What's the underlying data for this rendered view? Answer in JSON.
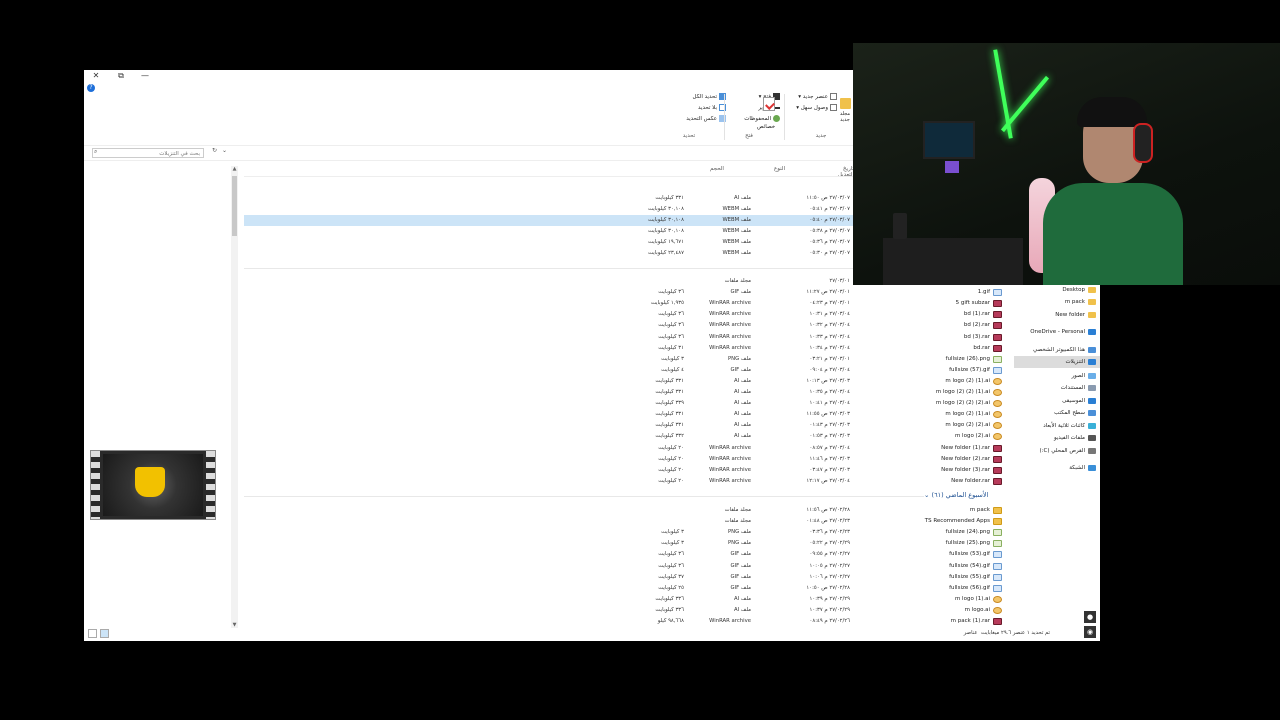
{
  "window": {
    "minimize": "—",
    "restore": "⧉",
    "close": "✕",
    "help": "?"
  },
  "ribbon": {
    "new_group_label": "جديد",
    "new_item": "عنصر جديد",
    "easy_access": "وصول سهل",
    "new_folder": "مجلد جديد",
    "properties": "خصائص",
    "open": "فتح",
    "edit": "تحرير",
    "history": "المحفوظات",
    "open_group_label": "فتح",
    "select_all": "تحديد الكل",
    "select_none": "بلا تحديد",
    "invert_selection": "عكس التحديد",
    "select_group_label": "تحديد"
  },
  "search": {
    "placeholder": "بحث في التنزيلات"
  },
  "columns": {
    "modified": "تاريخ التعديل",
    "type": "النوع",
    "size": "الحجم"
  },
  "top_rows": [
    {
      "date": "٢٧/٠٣/٠٧ ص ١١:٥٠",
      "type": "ملف AI",
      "size": "٣٣١ كيلوبايت",
      "selected": false
    },
    {
      "date": "٢٧/٠٣/٠٧ م ٠٥:٤١",
      "type": "ملف WEBM",
      "size": "٣٠,١٠٨ كيلوبايت",
      "selected": false
    },
    {
      "date": "٢٧/٠٣/٠٧ م ٠٥:٤٠",
      "type": "ملف WEBM",
      "size": "٣٠,١٠٨ كيلوبايت",
      "selected": true
    },
    {
      "date": "٢٧/٠٣/٠٧ م ٠٥:٣٨",
      "type": "ملف WEBM",
      "size": "٣٠,١٠٨ كيلوبايت",
      "selected": false
    },
    {
      "date": "٢٧/٠٣/٠٧ م ٠٥:٣٦",
      "type": "ملف WEBM",
      "size": "١٩,٦٧١ كيلوبايت",
      "selected": false
    },
    {
      "date": "٢٧/٠٣/٠٧ م ٠٥:٣٠",
      "type": "ملف WEBM",
      "size": "٢٣,٤٨٧ كيلوبايت",
      "selected": false
    }
  ],
  "earlier_rows": [
    {
      "name": "",
      "icon": "folder",
      "date": "٢٧/٠٣/٠١",
      "type": "مجلد ملفات",
      "size": ""
    },
    {
      "name": "1.gif",
      "icon": "gif",
      "date": "٢٧/٠٣/٠١ ص ١١:٢٧",
      "type": "ملف GIF",
      "size": "٣٦ كيلوبايت"
    },
    {
      "name": "5 gift subzar",
      "icon": "rar",
      "date": "٢٧/٠٣/٠١ م ٠٤:٢٣",
      "type": "WinRAR archive",
      "size": "١,٩٣٥ كيلوبايت"
    },
    {
      "name": "bd (1).rar",
      "icon": "rar",
      "date": "٢٧/٠٣/٠٤ م ١٠:٣١",
      "type": "WinRAR archive",
      "size": "٣٦ كيلوبايت"
    },
    {
      "name": "bd (2).rar",
      "icon": "rar",
      "date": "٢٧/٠٣/٠٤ م ١٠:٣٢",
      "type": "WinRAR archive",
      "size": "٣٦ كيلوبايت"
    },
    {
      "name": "bd (3).rar",
      "icon": "rar",
      "date": "٢٧/٠٣/٠٤ م ١٠:٣٣",
      "type": "WinRAR archive",
      "size": "٣٦ كيلوبايت"
    },
    {
      "name": "bd.rar",
      "icon": "rar",
      "date": "٢٧/٠٣/٠٤ م ١٠:٣٤",
      "type": "WinRAR archive",
      "size": "٣١ كيلوبايت"
    },
    {
      "name": "fullsize (26).png",
      "icon": "png",
      "date": "٢٧/٠٣/٠١ م ٠٣:٢١",
      "type": "ملف PNG",
      "size": "٣ كيلوبايت"
    },
    {
      "name": "fullsize (57).gif",
      "icon": "gif",
      "date": "٢٧/٠٣/٠٤ م ٠٩:٠٤",
      "type": "ملف GIF",
      "size": "٤ كيلوبايت"
    },
    {
      "name": "m logo (2) (1).ai",
      "icon": "ai",
      "date": "٢٧/٠٣/٠٣ ص ١٠:١٣",
      "type": "ملف AI",
      "size": "٣٣١ كيلوبايت"
    },
    {
      "name": "m logo (2) (2) (1).ai",
      "icon": "ai",
      "date": "٢٧/٠٣/٠٤ م ١٠:٣٥",
      "type": "ملف AI",
      "size": "٣٣١ كيلوبايت"
    },
    {
      "name": "m logo (2) (2) (2).ai",
      "icon": "ai",
      "date": "٢٧/٠٣/٠٤ م ١٠:٤١",
      "type": "ملف AI",
      "size": "٣٣٩ كيلوبايت"
    },
    {
      "name": "m logo (2) (1).ai",
      "icon": "ai",
      "date": "٢٧/٠٣/٠٣ ص ١١:٥٥",
      "type": "ملف AI",
      "size": "٣٣١ كيلوبايت"
    },
    {
      "name": "m logo (2) (2).ai",
      "icon": "ai",
      "date": "٢٧/٠٣/٠٣ م ٠١:٤٣",
      "type": "ملف AI",
      "size": "٣٣١ كيلوبايت"
    },
    {
      "name": "m logo (2).ai",
      "icon": "ai",
      "date": "٢٧/٠٣/٠٣ م ٠١:٥٣",
      "type": "ملف AI",
      "size": "٣٣٢ كيلوبايت"
    },
    {
      "name": "New folder (1).rar",
      "icon": "rar",
      "date": "٢٧/٠٣/٠٤ م ٠٨:٥٧",
      "type": "WinRAR archive",
      "size": "٢٠ كيلوبايت"
    },
    {
      "name": "New folder (2).rar",
      "icon": "rar",
      "date": "٢٧/٠٣/٠٣ م ١١:٤٦",
      "type": "WinRAR archive",
      "size": "٢٠ كيلوبايت"
    },
    {
      "name": "New folder (3).rar",
      "icon": "rar",
      "date": "٢٧/٠٣/٠٣ م ٠٣:٤٧",
      "type": "WinRAR archive",
      "size": "٢٠ كيلوبايت"
    },
    {
      "name": "New folder.rar",
      "icon": "rar",
      "date": "٢٧/٠٣/٠٤ ص ١٢:١٧",
      "type": "WinRAR archive",
      "size": "٢٠ كيلوبايت"
    }
  ],
  "last_week_group": "الأسبوع الماضي (٦١)",
  "last_week_rows": [
    {
      "name": "m pack",
      "icon": "folder",
      "date": "٢٧/٠٢/٢٨ ص ١١:٥٦",
      "type": "مجلد ملفات",
      "size": ""
    },
    {
      "name": "TS Recommended Apps",
      "icon": "folder",
      "date": "٢٧/٠٢/٢٣ ص ٠١:٤٨",
      "type": "مجلد ملفات",
      "size": ""
    },
    {
      "name": "fullsize (24).png",
      "icon": "png",
      "date": "٢٧/٠٢/٢٣ م ٠٣:٣٦",
      "type": "ملف PNG",
      "size": "٣ كيلوبايت"
    },
    {
      "name": "fullsize (25).png",
      "icon": "png",
      "date": "٢٧/٠٢/٢٩ م ٠٥:٢٢",
      "type": "ملف PNG",
      "size": "٣ كيلوبايت"
    },
    {
      "name": "fullsize (53).gif",
      "icon": "gif",
      "date": "٢٧/٠٢/٢٧ م ٠٩:٥٥",
      "type": "ملف GIF",
      "size": "٣٦ كيلوبايت"
    },
    {
      "name": "fullsize (54).gif",
      "icon": "gif",
      "date": "٢٧/٠٢/٢٧ م ١٠:٠٥",
      "type": "ملف GIF",
      "size": "٣٦ كيلوبايت"
    },
    {
      "name": "fullsize (55).gif",
      "icon": "gif",
      "date": "٢٧/٠٢/٢٧ م ١٠:٠٦",
      "type": "ملف GIF",
      "size": "٣٧ كيلوبايت"
    },
    {
      "name": "fullsize (56).gif",
      "icon": "gif",
      "date": "٢٧/٠٢/٢٨ ص ١٠:٥٠",
      "type": "ملف GIF",
      "size": "٢٥ كيلوبايت"
    },
    {
      "name": "m logo (1).ai",
      "icon": "ai",
      "date": "٢٧/٠٢/٢٩ م ١٠:٣٩",
      "type": "ملف AI",
      "size": "٣٣٦ كيلوبايت"
    },
    {
      "name": "m logo.ai",
      "icon": "ai",
      "date": "٢٧/٠٢/٢٩ م ١٠:٣٧",
      "type": "ملف AI",
      "size": "٣٣٦ كيلوبايت"
    },
    {
      "name": "m pack (1).rar",
      "icon": "rar",
      "date": "٢٧/٠٢/٢٦ م ٠٨:٤٩",
      "type": "WinRAR archive",
      "size": "٩٨,٦٦٨ كيلو"
    }
  ],
  "nav": [
    {
      "label": "Desktop",
      "icon": "folder"
    },
    {
      "label": "m pack",
      "icon": "folder"
    },
    {
      "label": "New folder",
      "icon": "folder"
    },
    {
      "label": "OneDrive - Personal",
      "icon": "cloud"
    },
    {
      "label": "هذا الكمبيوتر الشخصي",
      "icon": "pc"
    },
    {
      "label": "التنزيلات",
      "icon": "download",
      "selected": true
    },
    {
      "label": "الصور",
      "icon": "pictures"
    },
    {
      "label": "المستندات",
      "icon": "documents"
    },
    {
      "label": "الموسيقى",
      "icon": "music"
    },
    {
      "label": "سطح المكتب",
      "icon": "desktop"
    },
    {
      "label": "كائنات ثلاثية الأبعاد",
      "icon": "objects3d"
    },
    {
      "label": "ملفات الفيديو",
      "icon": "video"
    },
    {
      "label": "القرص المحلي (C:)",
      "icon": "drive"
    },
    {
      "label": "الشبكة",
      "icon": "network"
    }
  ],
  "status": {
    "text": "تم تحديد ١ عنصر ٢٩.٦ ميغابايت",
    "items": "عناصر"
  },
  "colors": {
    "selection": "#cce4f7",
    "accent": "#1e6fd9",
    "rar_icon": "#b63a5a",
    "folder_icon": "#f0c14b"
  }
}
